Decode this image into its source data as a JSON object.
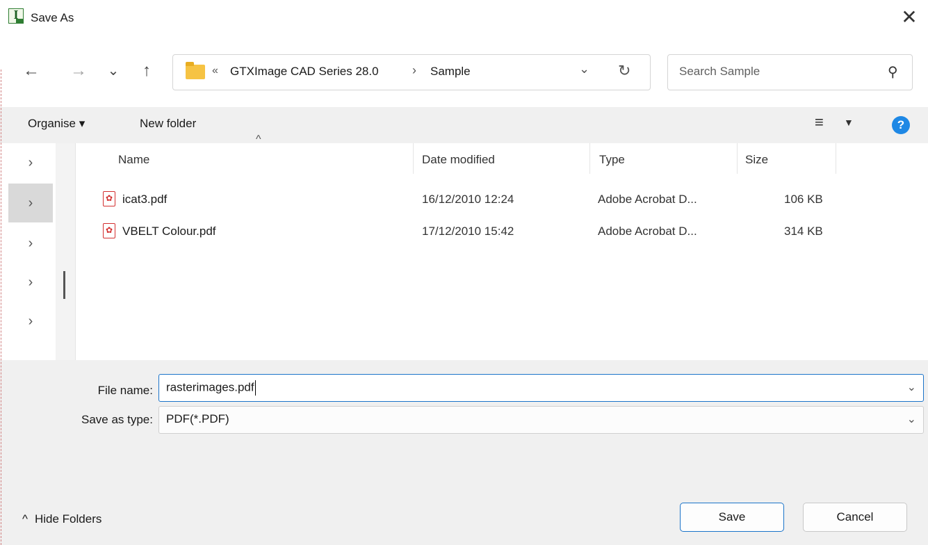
{
  "window": {
    "title": "Save As",
    "app_icon_letter": "I",
    "close_glyph": "✕"
  },
  "nav": {
    "back_glyph": "←",
    "forward_glyph": "→",
    "recent_glyph": "⌄",
    "up_glyph": "↑",
    "address": {
      "overflow_glyph": "«",
      "segment1": "GTXImage CAD Series 28.0",
      "separator": "›",
      "segment2": "Sample",
      "dropdown_glyph": "⌄",
      "refresh_glyph": "↻"
    },
    "search": {
      "placeholder": "Search Sample",
      "icon_glyph": "⚲"
    }
  },
  "command_bar": {
    "organise_label": "Organise ▾",
    "new_folder_label": "New folder",
    "view_glyph": "≡",
    "view_dropdown_glyph": "▼",
    "help_glyph": "?"
  },
  "nav_pane": {
    "chevron_glyph": "›",
    "rows": 5,
    "selected_index": 1
  },
  "file_list": {
    "sort_glyph": "^",
    "columns": {
      "name": "Name",
      "date": "Date modified",
      "type": "Type",
      "size": "Size"
    },
    "rows": [
      {
        "name": "icat3.pdf",
        "date": "16/12/2010 12:24",
        "type": "Adobe Acrobat D...",
        "size": "106 KB"
      },
      {
        "name": "VBELT Colour.pdf",
        "date": "17/12/2010 15:42",
        "type": "Adobe Acrobat D...",
        "size": "314 KB"
      }
    ]
  },
  "form": {
    "file_name_label": "File name:",
    "file_name_value": "rasterimages.pdf",
    "save_type_label": "Save as type:",
    "save_type_value": "PDF(*.PDF)",
    "dropdown_glyph": "⌄"
  },
  "footer": {
    "hide_folders_glyph": "^",
    "hide_folders_label": "Hide Folders",
    "save_label": "Save",
    "cancel_label": "Cancel"
  },
  "colors": {
    "accent": "#1a73c9",
    "pdf_red": "#d32f2f",
    "folder_yellow": "#f6c343",
    "help_blue": "#1e88e5"
  }
}
